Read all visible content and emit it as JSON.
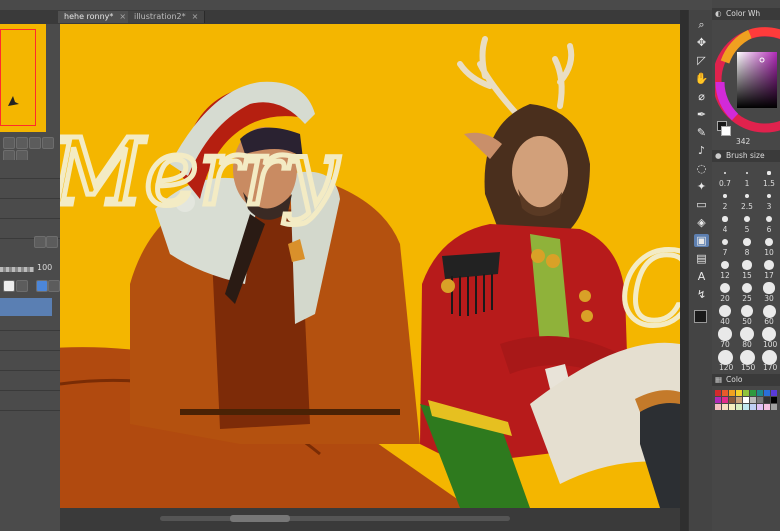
{
  "tabs": [
    {
      "label": "hehe ronny*",
      "close": "×"
    },
    {
      "label": "illustration2*",
      "close": "×"
    }
  ],
  "left_panel": {
    "opacity_value": "100"
  },
  "canvas": {
    "background": "#f4b600",
    "lettering_left": "Merry",
    "lettering_right": "Christ"
  },
  "right_panel": {
    "color_wheel_title": "Color Wh",
    "color_sub_value": "342",
    "brush_size_title": "Brush size",
    "brush_sizes": [
      "0.7",
      "1",
      "1.5",
      "2",
      "2.5",
      "3",
      "4",
      "5",
      "6",
      "7",
      "8",
      "10",
      "12",
      "15",
      "17",
      "20",
      "25",
      "30",
      "40",
      "50",
      "60",
      "70",
      "80",
      "100",
      "120",
      "150",
      "170"
    ],
    "color_set_title": "Colo"
  },
  "tools": [
    "zoom-icon",
    "move-icon",
    "transform-icon",
    "hand-icon",
    "eyedropper-icon",
    "pen-icon",
    "pencil-icon",
    "brush-icon",
    "airbrush-icon",
    "blend-icon",
    "eraser-icon",
    "fill-icon",
    "figure-icon",
    "frame-icon",
    "text-icon",
    "correct-line-icon",
    "color-icon"
  ],
  "colors": {
    "main_color": "#1a1a1a",
    "sub_color": "#ffffff",
    "selection_blue": "#5a7fb3"
  }
}
